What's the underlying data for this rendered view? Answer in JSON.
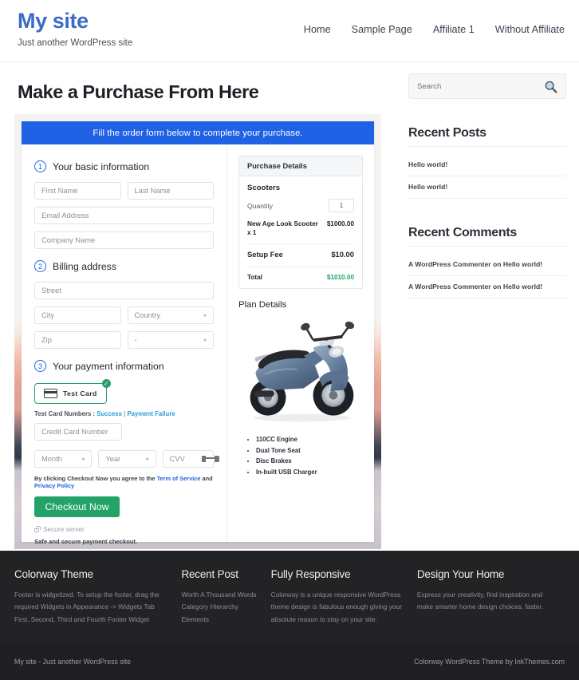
{
  "header": {
    "site_title": "My site",
    "tagline": "Just another WordPress site",
    "nav": [
      {
        "label": "Home"
      },
      {
        "label": "Sample Page"
      },
      {
        "label": "Affiliate 1"
      },
      {
        "label": "Without Affiliate"
      }
    ]
  },
  "main": {
    "page_title": "Make a Purchase From Here",
    "form": {
      "banner": "Fill the order form below to complete your purchase.",
      "step1": {
        "number": "1",
        "label": "Your basic information",
        "first_name_placeholder": "First Name",
        "last_name_placeholder": "Last Name",
        "email_placeholder": "Email Address",
        "company_placeholder": "Company Name"
      },
      "step2": {
        "number": "2",
        "label": "Billing address",
        "street_placeholder": "Street",
        "city_placeholder": "City",
        "country_placeholder": "Country",
        "zip_placeholder": "Zip",
        "state_placeholder": "-"
      },
      "step3": {
        "number": "3",
        "label": "Your payment information",
        "method_label": "Test  Card",
        "test_cards_prefix": "Test Card Numbers : ",
        "test_success": "Success",
        "test_separator": " | ",
        "test_failure": "Payment Failure",
        "card_number_placeholder": "Credit Card Number",
        "month_placeholder": "Month",
        "year_placeholder": "Year",
        "cvv_placeholder": "CVV",
        "tos_prefix": "By clicking Checkout Now you agree to the ",
        "tos_terms": "Term of Service",
        "tos_and": " and ",
        "tos_privacy": "Privacy Policy",
        "checkout_label": "Checkout Now",
        "secure_server": "Secure server",
        "safe_note": "Safe and secure payment checkout."
      },
      "purchase_details": {
        "panel_title": "Purchase Details",
        "product_group": "Scooters",
        "quantity_label": "Quantity",
        "quantity_value": "1",
        "item_name": "New Age Look Scooter x 1",
        "item_amount": "$1000.00",
        "setup_label": "Setup Fee",
        "setup_amount": "$10.00",
        "total_label": "Total",
        "total_amount": "$1010.00"
      },
      "plan_details": {
        "title": "Plan Details",
        "features": [
          "110CC Engine",
          "Dual Tone Seat",
          "Disc Brakes",
          "In-built USB Charger"
        ]
      }
    }
  },
  "sidebar": {
    "search_placeholder": "Search",
    "recent_posts": {
      "title": "Recent Posts",
      "items": [
        "Hello world!",
        "Hello world!"
      ]
    },
    "recent_comments": {
      "title": "Recent Comments",
      "items": [
        "A WordPress Commenter on Hello world!",
        "A WordPress Commenter on Hello world!"
      ]
    }
  },
  "footer": {
    "columns": [
      {
        "title": "Colorway Theme",
        "text": "Footer is widgetized. To setup the footer, drag the required Widgets in Appearance -> Widgets Tab First, Second, Third and Fourth Footer Widget"
      },
      {
        "title": "Recent Post",
        "links": [
          "Worth A Thousand Words",
          "Category Hierarchy",
          "Elements"
        ]
      },
      {
        "title": "Fully Responsive",
        "text": "Colorway is a unique responsive WordPress theme design is fabulous enough giving your absolute reason to stay on your site."
      },
      {
        "title": "Design Your Home",
        "text": "Express your creativity, find inspiration and make smarter home design choices, faster."
      }
    ],
    "bottom_left": "My site - Just another WordPress site",
    "bottom_right": "Colorway WordPress Theme by InkThemes.com"
  },
  "colors": {
    "brand_blue": "#3a6bc7",
    "banner_blue": "#2062e6",
    "accent_green": "#23a367",
    "link_blue": "#2a9ad6",
    "footer_dark": "#232325"
  }
}
